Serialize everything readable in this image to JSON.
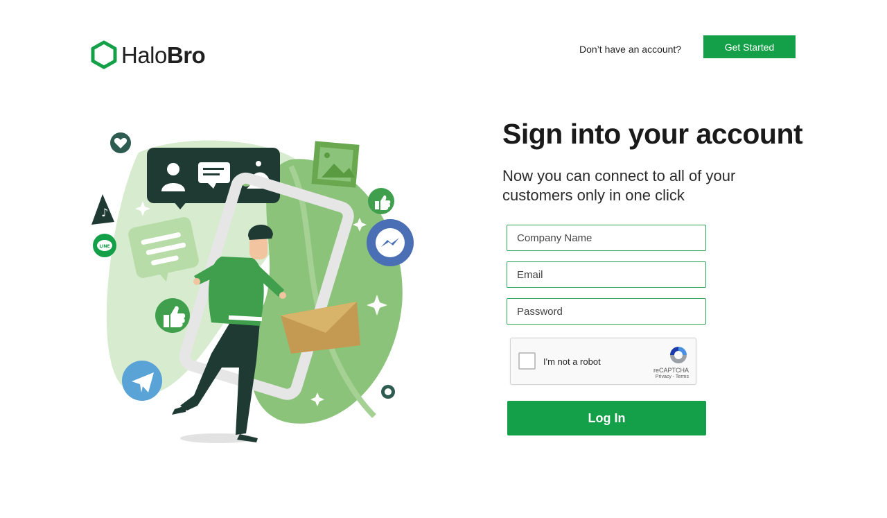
{
  "brand": {
    "name_part1": "Halo",
    "name_part2": "Bro",
    "logo_icon": "hexagon-logo-icon"
  },
  "header": {
    "prompt_text": "Don’t have an account?",
    "cta_label": "Get Started"
  },
  "form": {
    "title": "Sign into your account",
    "subtitle": "Now you can connect to all of your customers only in one click",
    "company_placeholder": "Company Name",
    "email_placeholder": "Email",
    "password_placeholder": "Password",
    "captcha": {
      "label": "I'm not a robot",
      "brand": "reCAPTCHA",
      "terms": "Privacy - Terms"
    },
    "submit_label": "Log In"
  },
  "illustration": {
    "badge_text": "LINE"
  },
  "colors": {
    "accent": "#14a048",
    "dark": "#1f3a33",
    "leaf": "#8cc37a"
  }
}
